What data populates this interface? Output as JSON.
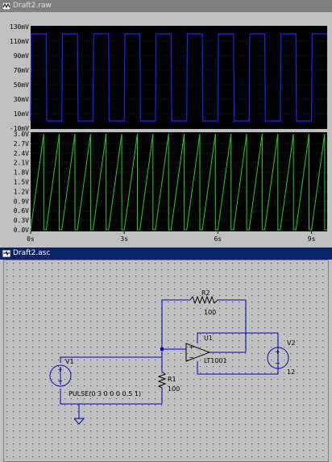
{
  "windows": {
    "plot": {
      "title": "Draft2.raw"
    },
    "schematic": {
      "title": "Draft2.asc"
    }
  },
  "plot": {
    "top_pane": {
      "y_ticks": [
        "130mV",
        "110mV",
        "90mV",
        "70mV",
        "50mV",
        "30mV",
        "10mV",
        "-10mV"
      ],
      "color": "#2020ff"
    },
    "bottom_pane": {
      "y_ticks": [
        "3.0V",
        "2.7V",
        "2.4V",
        "2.1V",
        "1.8V",
        "1.5V",
        "1.2V",
        "0.9V",
        "0.6V",
        "0.3V",
        "0.0V"
      ],
      "color": "#20d020"
    },
    "x_ticks": [
      "0s",
      "3s",
      "6s",
      "9s"
    ]
  },
  "chart_data": [
    {
      "type": "line",
      "series": [
        {
          "values_mV": [
            0,
            120
          ]
        }
      ],
      "x_unit": "s",
      "y_range_mV": [
        -10,
        130
      ],
      "xlim_s": [
        0,
        9.5
      ],
      "description_values": {
        "period_s": 1,
        "low_mV": 0,
        "high_mV": 120
      },
      "grid": true
    },
    {
      "type": "line",
      "series": [
        {
          "values_V": [
            0,
            3
          ]
        }
      ],
      "x_unit": "s",
      "y_range_V": [
        0,
        3
      ],
      "xlim_s": [
        0,
        9.5
      ],
      "grid": true
    }
  ],
  "schematic": {
    "v1": {
      "name": "V1",
      "value": "PULSE(0 3 0 0 0 0.5 1)"
    },
    "r1": {
      "name": "R1",
      "value": "100"
    },
    "r2": {
      "name": "R2",
      "value": "100"
    },
    "u1": {
      "name": "U1",
      "value": "LT1001"
    },
    "v2": {
      "name": "V2",
      "value": "12"
    }
  }
}
